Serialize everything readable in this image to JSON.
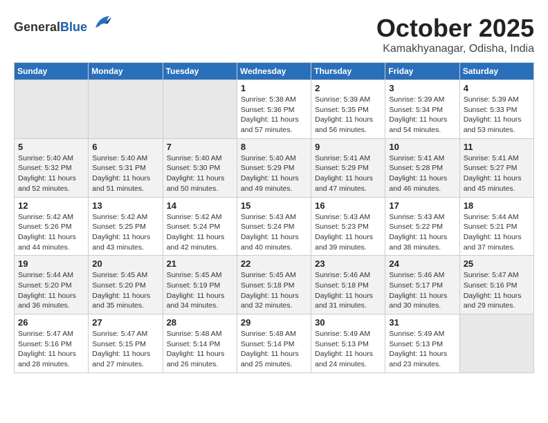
{
  "logo": {
    "general": "General",
    "blue": "Blue"
  },
  "header": {
    "month": "October 2025",
    "location": "Kamakhyanagar, Odisha, India"
  },
  "weekdays": [
    "Sunday",
    "Monday",
    "Tuesday",
    "Wednesday",
    "Thursday",
    "Friday",
    "Saturday"
  ],
  "weeks": [
    [
      {
        "day": "",
        "info": ""
      },
      {
        "day": "",
        "info": ""
      },
      {
        "day": "",
        "info": ""
      },
      {
        "day": "1",
        "info": "Sunrise: 5:38 AM\nSunset: 5:36 PM\nDaylight: 11 hours and 57 minutes."
      },
      {
        "day": "2",
        "info": "Sunrise: 5:39 AM\nSunset: 5:35 PM\nDaylight: 11 hours and 56 minutes."
      },
      {
        "day": "3",
        "info": "Sunrise: 5:39 AM\nSunset: 5:34 PM\nDaylight: 11 hours and 54 minutes."
      },
      {
        "day": "4",
        "info": "Sunrise: 5:39 AM\nSunset: 5:33 PM\nDaylight: 11 hours and 53 minutes."
      }
    ],
    [
      {
        "day": "5",
        "info": "Sunrise: 5:40 AM\nSunset: 5:32 PM\nDaylight: 11 hours and 52 minutes."
      },
      {
        "day": "6",
        "info": "Sunrise: 5:40 AM\nSunset: 5:31 PM\nDaylight: 11 hours and 51 minutes."
      },
      {
        "day": "7",
        "info": "Sunrise: 5:40 AM\nSunset: 5:30 PM\nDaylight: 11 hours and 50 minutes."
      },
      {
        "day": "8",
        "info": "Sunrise: 5:40 AM\nSunset: 5:29 PM\nDaylight: 11 hours and 49 minutes."
      },
      {
        "day": "9",
        "info": "Sunrise: 5:41 AM\nSunset: 5:29 PM\nDaylight: 11 hours and 47 minutes."
      },
      {
        "day": "10",
        "info": "Sunrise: 5:41 AM\nSunset: 5:28 PM\nDaylight: 11 hours and 46 minutes."
      },
      {
        "day": "11",
        "info": "Sunrise: 5:41 AM\nSunset: 5:27 PM\nDaylight: 11 hours and 45 minutes."
      }
    ],
    [
      {
        "day": "12",
        "info": "Sunrise: 5:42 AM\nSunset: 5:26 PM\nDaylight: 11 hours and 44 minutes."
      },
      {
        "day": "13",
        "info": "Sunrise: 5:42 AM\nSunset: 5:25 PM\nDaylight: 11 hours and 43 minutes."
      },
      {
        "day": "14",
        "info": "Sunrise: 5:42 AM\nSunset: 5:24 PM\nDaylight: 11 hours and 42 minutes."
      },
      {
        "day": "15",
        "info": "Sunrise: 5:43 AM\nSunset: 5:24 PM\nDaylight: 11 hours and 40 minutes."
      },
      {
        "day": "16",
        "info": "Sunrise: 5:43 AM\nSunset: 5:23 PM\nDaylight: 11 hours and 39 minutes."
      },
      {
        "day": "17",
        "info": "Sunrise: 5:43 AM\nSunset: 5:22 PM\nDaylight: 11 hours and 38 minutes."
      },
      {
        "day": "18",
        "info": "Sunrise: 5:44 AM\nSunset: 5:21 PM\nDaylight: 11 hours and 37 minutes."
      }
    ],
    [
      {
        "day": "19",
        "info": "Sunrise: 5:44 AM\nSunset: 5:20 PM\nDaylight: 11 hours and 36 minutes."
      },
      {
        "day": "20",
        "info": "Sunrise: 5:45 AM\nSunset: 5:20 PM\nDaylight: 11 hours and 35 minutes."
      },
      {
        "day": "21",
        "info": "Sunrise: 5:45 AM\nSunset: 5:19 PM\nDaylight: 11 hours and 34 minutes."
      },
      {
        "day": "22",
        "info": "Sunrise: 5:45 AM\nSunset: 5:18 PM\nDaylight: 11 hours and 32 minutes."
      },
      {
        "day": "23",
        "info": "Sunrise: 5:46 AM\nSunset: 5:18 PM\nDaylight: 11 hours and 31 minutes."
      },
      {
        "day": "24",
        "info": "Sunrise: 5:46 AM\nSunset: 5:17 PM\nDaylight: 11 hours and 30 minutes."
      },
      {
        "day": "25",
        "info": "Sunrise: 5:47 AM\nSunset: 5:16 PM\nDaylight: 11 hours and 29 minutes."
      }
    ],
    [
      {
        "day": "26",
        "info": "Sunrise: 5:47 AM\nSunset: 5:16 PM\nDaylight: 11 hours and 28 minutes."
      },
      {
        "day": "27",
        "info": "Sunrise: 5:47 AM\nSunset: 5:15 PM\nDaylight: 11 hours and 27 minutes."
      },
      {
        "day": "28",
        "info": "Sunrise: 5:48 AM\nSunset: 5:14 PM\nDaylight: 11 hours and 26 minutes."
      },
      {
        "day": "29",
        "info": "Sunrise: 5:48 AM\nSunset: 5:14 PM\nDaylight: 11 hours and 25 minutes."
      },
      {
        "day": "30",
        "info": "Sunrise: 5:49 AM\nSunset: 5:13 PM\nDaylight: 11 hours and 24 minutes."
      },
      {
        "day": "31",
        "info": "Sunrise: 5:49 AM\nSunset: 5:13 PM\nDaylight: 11 hours and 23 minutes."
      },
      {
        "day": "",
        "info": ""
      }
    ]
  ]
}
